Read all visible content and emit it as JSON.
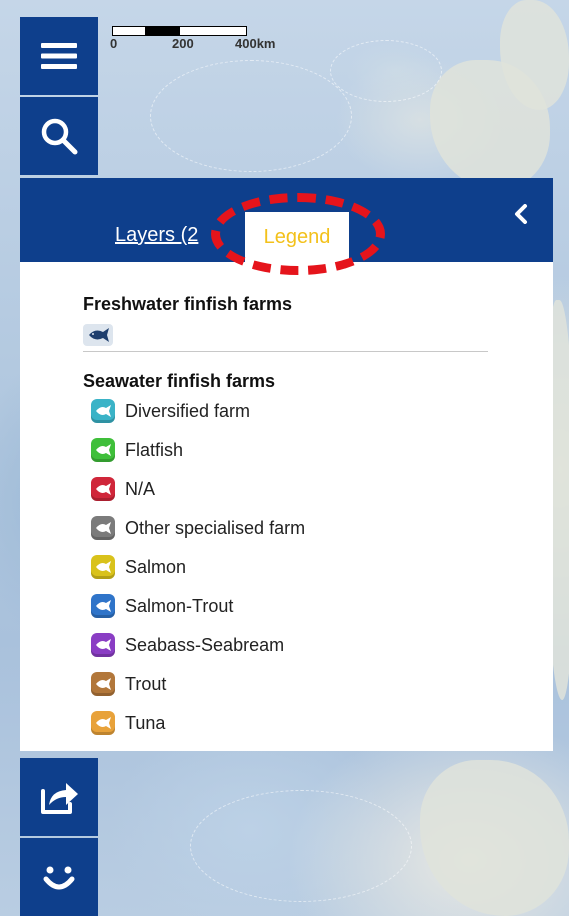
{
  "scale": {
    "labels": [
      "0",
      "200",
      "400km"
    ]
  },
  "toolbar": {
    "top": [
      {
        "name": "menu-button",
        "icon": "hamburger-menu-icon"
      },
      {
        "name": "search-button",
        "icon": "search-icon"
      }
    ],
    "bottom": [
      {
        "name": "share-button",
        "icon": "share-icon"
      },
      {
        "name": "feedback-button",
        "icon": "smiley-icon"
      }
    ]
  },
  "panel": {
    "tabs": {
      "layers_label": "Layers (2",
      "legend_label": "Legend"
    },
    "collapse_icon": "chevron-left-icon",
    "freshwater": {
      "title": "Freshwater finfish farms",
      "icon": "fish-icon"
    },
    "seawater": {
      "title": "Seawater finfish farms",
      "items": [
        {
          "label": "Diversified farm",
          "color": "#3ab3c7"
        },
        {
          "label": "Flatfish",
          "color": "#3fbf3a"
        },
        {
          "label": "N/A",
          "color": "#d0263a"
        },
        {
          "label": "Other specialised farm",
          "color": "#7b7b7b"
        },
        {
          "label": "Salmon",
          "color": "#d9c21b"
        },
        {
          "label": "Salmon-Trout",
          "color": "#2f74c9"
        },
        {
          "label": "Seabass-Seabream",
          "color": "#8a3dc4"
        },
        {
          "label": "Trout",
          "color": "#b2773a"
        },
        {
          "label": "Tuna",
          "color": "#e8a23a"
        }
      ]
    }
  },
  "colors": {
    "brand": "#0e3f8c",
    "active_tab_text": "#f3c11b",
    "highlight": "#e5141b"
  }
}
